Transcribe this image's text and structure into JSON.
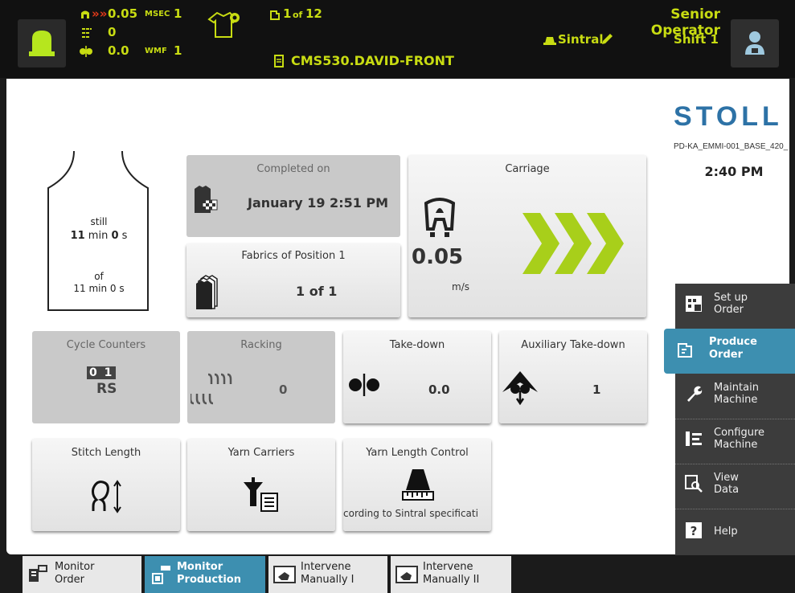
{
  "header": {
    "speed_value": "0.05",
    "speed_unit": "MSEC",
    "speed_index": "1",
    "racking_value": "0",
    "takedown_value": "0.0",
    "takedown_unit": "WMF",
    "takedown_index": "1",
    "count_current": "1",
    "count_of": "of",
    "count_total": "12",
    "program_name": "CMS530.DAVID-FRONT",
    "sintral_label": "Sintral",
    "user_role": "Senior Operator",
    "shift": "Shift 1"
  },
  "brand": {
    "logo": "STOLL",
    "pattern_id": "PD-KA_EMMI-001_BASE_420_",
    "time": "2:40 PM"
  },
  "garment": {
    "still_label": "still",
    "still_min": "11",
    "still_min_unit": "min",
    "still_sec": "0",
    "still_sec_unit": "s",
    "of_label": "of",
    "total_time": "11 min 0 s"
  },
  "tiles": {
    "completed": {
      "title": "Completed on",
      "value": "January 19 2:51 PM"
    },
    "fabrics": {
      "title": "Fabrics of Position 1",
      "value": "1 of 1"
    },
    "carriage": {
      "title": "Carriage",
      "value": "0.05",
      "unit": "m/s"
    },
    "cycle": {
      "title": "Cycle Counters",
      "code": "0 1",
      "sub": "RS"
    },
    "racking": {
      "title": "Racking",
      "value": "0"
    },
    "takedown": {
      "title": "Take-down",
      "value": "0.0"
    },
    "aux": {
      "title": "Auxiliary Take-down",
      "value": "1"
    },
    "stitch": {
      "title": "Stitch Length"
    },
    "yarn_carriers": {
      "title": "Yarn Carriers"
    },
    "ylc": {
      "title": "Yarn Length Control",
      "value": "cording to Sintral specificati"
    }
  },
  "side_menu": [
    {
      "line1": "Set up",
      "line2": "Order"
    },
    {
      "line1": "Produce",
      "line2": "Order"
    },
    {
      "line1": "Maintain",
      "line2": "Machine"
    },
    {
      "line1": "Configure",
      "line2": "Machine"
    },
    {
      "line1": "View",
      "line2": "Data"
    },
    {
      "line1": "Help",
      "line2": ""
    }
  ],
  "bottom_tabs": [
    {
      "line1": "Monitor",
      "line2": "Order"
    },
    {
      "line1": "Monitor",
      "line2": "Production"
    },
    {
      "line1": "Intervene",
      "line2": "Manually I"
    },
    {
      "line1": "Intervene",
      "line2": "Manually II"
    }
  ],
  "colors": {
    "accent_yellow": "#c8dc12",
    "chevron_green": "#a8cf1a",
    "selected_blue": "#3d8fb0"
  }
}
